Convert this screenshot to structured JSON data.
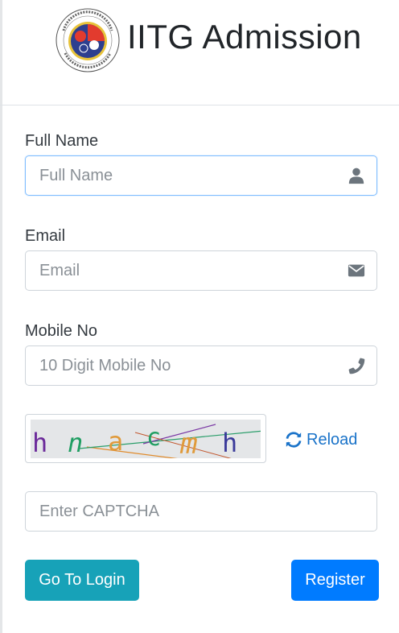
{
  "header": {
    "title": "IITG Admission",
    "logo_icon": "iitg-logo"
  },
  "form": {
    "full_name": {
      "label": "Full Name",
      "placeholder": "Full Name",
      "icon": "user-icon"
    },
    "email": {
      "label": "Email",
      "placeholder": "Email",
      "icon": "envelope-icon"
    },
    "mobile": {
      "label": "Mobile No",
      "placeholder": "10 Digit Mobile No",
      "icon": "phone-icon"
    },
    "captcha": {
      "text": "hnacmh",
      "reload_label": "Reload",
      "input_placeholder": "Enter CAPTCHA"
    }
  },
  "buttons": {
    "login": "Go To Login",
    "register": "Register"
  },
  "colors": {
    "login": "#17a2b8",
    "register": "#007bff",
    "link": "#1a73c9"
  }
}
